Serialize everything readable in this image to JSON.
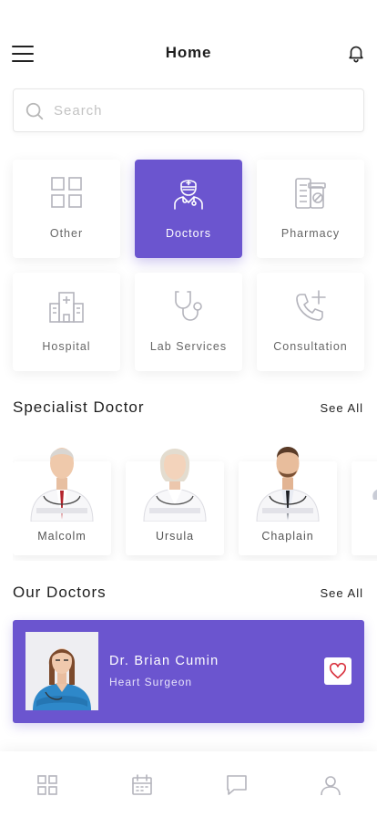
{
  "header": {
    "title": "Home"
  },
  "search": {
    "placeholder": "Search"
  },
  "categories": [
    {
      "label": "Other",
      "icon": "grid-icon",
      "active": false
    },
    {
      "label": "Doctors",
      "icon": "doctor-icon",
      "active": true
    },
    {
      "label": "Pharmacy",
      "icon": "pharmacy-icon",
      "active": false
    },
    {
      "label": "Hospital",
      "icon": "hospital-icon",
      "active": false
    },
    {
      "label": "Lab Services",
      "icon": "stethoscope-icon",
      "active": false
    },
    {
      "label": "Consultation",
      "icon": "phone-plus-icon",
      "active": false
    }
  ],
  "specialist": {
    "title": "Specialist Doctor",
    "see_all": "See All",
    "doctors": [
      {
        "name": "Malcolm"
      },
      {
        "name": "Ursula"
      },
      {
        "name": "Chaplain"
      }
    ]
  },
  "our_doctors": {
    "title": "Our Doctors",
    "see_all": "See All",
    "featured": {
      "name": "Dr. Brian Cumin",
      "role": "Heart Surgeon"
    }
  },
  "bottom_nav": [
    {
      "icon": "home-grid-icon"
    },
    {
      "icon": "calendar-icon"
    },
    {
      "icon": "chat-icon"
    },
    {
      "icon": "profile-icon"
    }
  ],
  "colors": {
    "accent": "#6b55cf",
    "icon_gray": "#b4b4bc",
    "heart": "#d9333f"
  }
}
